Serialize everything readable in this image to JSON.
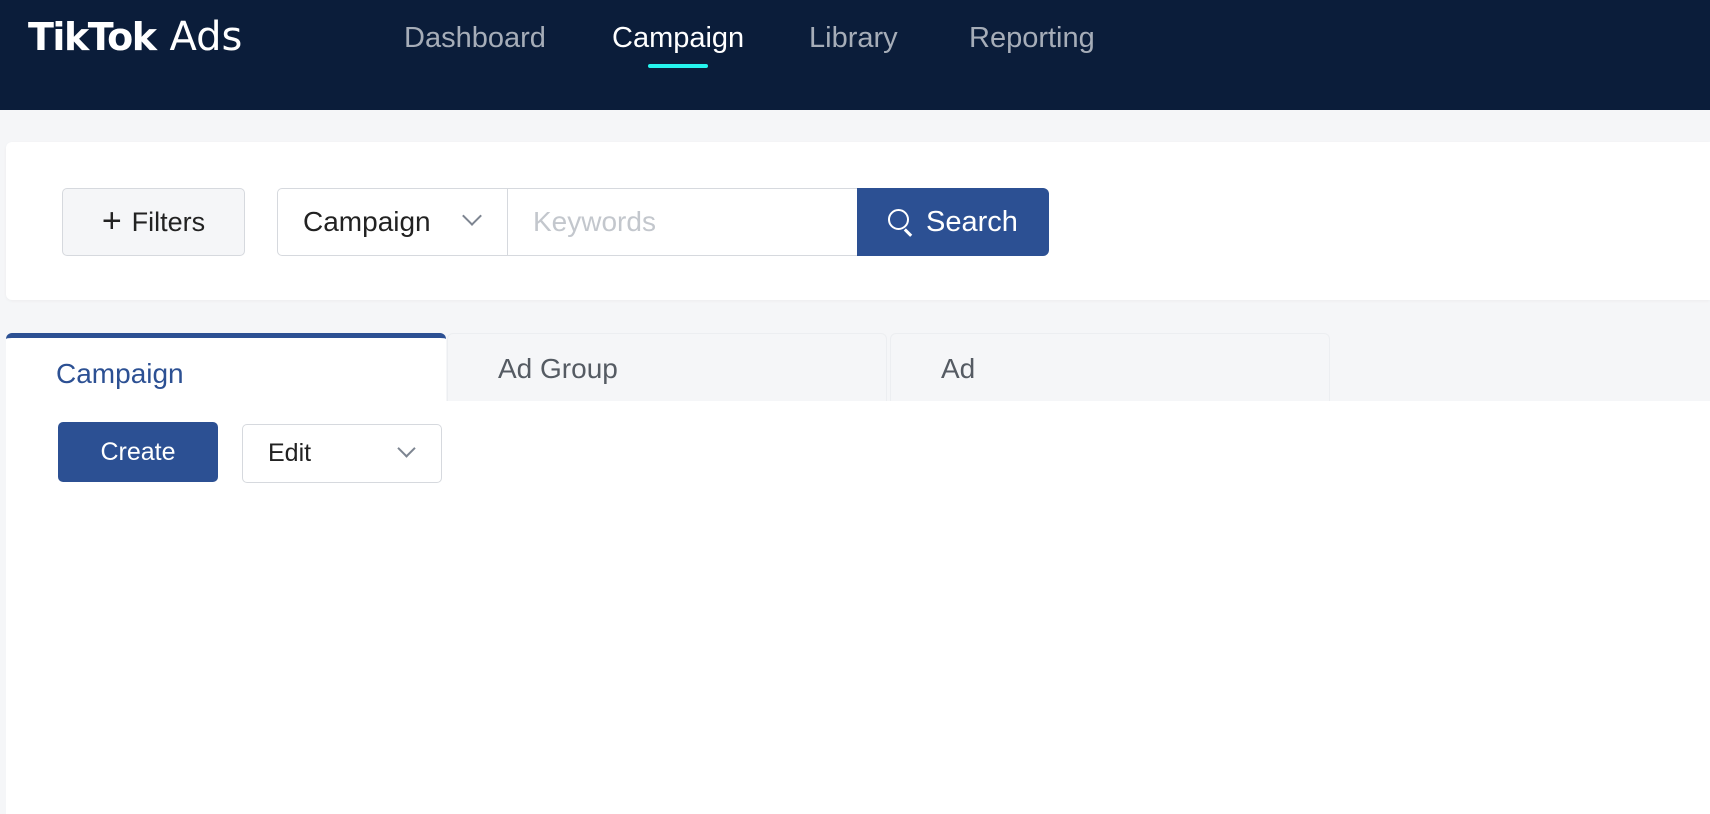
{
  "header": {
    "logo_brand": "TikTok",
    "logo_product": "Ads",
    "nav": [
      {
        "label": "Dashboard",
        "active": false
      },
      {
        "label": "Campaign",
        "active": true
      },
      {
        "label": "Library",
        "active": false
      },
      {
        "label": "Reporting",
        "active": false
      }
    ]
  },
  "search": {
    "filters_label": "Filters",
    "scope_value": "Campaign",
    "keyword_value": "",
    "keyword_placeholder": "Keywords",
    "search_label": "Search"
  },
  "tabs": [
    {
      "label": "Campaign",
      "active": true
    },
    {
      "label": "Ad Group",
      "active": false
    },
    {
      "label": "Ad",
      "active": false
    }
  ],
  "toolbar": {
    "create_label": "Create",
    "edit_label": "Edit"
  },
  "colors": {
    "header_bg": "#0b1d3a",
    "primary": "#2c5093",
    "nav_accent": "#25f4ee",
    "logo_red": "#fe2c55"
  },
  "icons": {
    "filters": "plus-icon",
    "search": "search-icon",
    "dropdown": "chevron-down-icon"
  }
}
